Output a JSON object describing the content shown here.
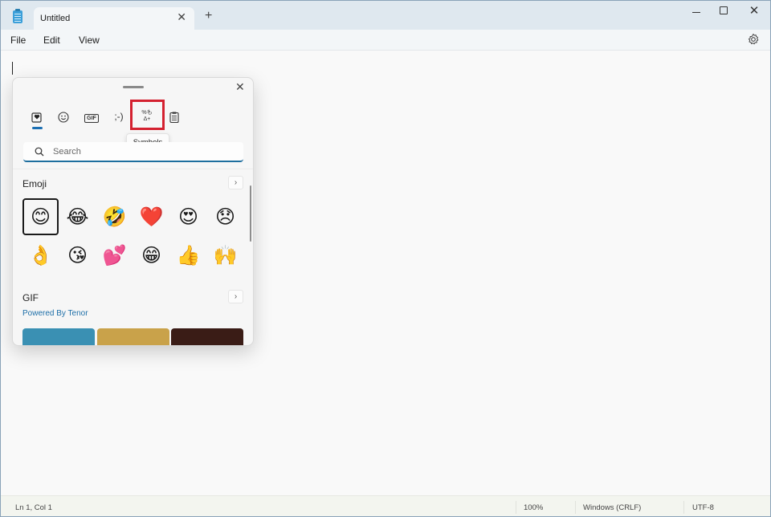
{
  "window": {
    "tab_title": "Untitled",
    "tab_close_glyph": "✕",
    "new_tab_glyph": "+",
    "close_glyph": "✕"
  },
  "menu": {
    "items": [
      "File",
      "Edit",
      "View"
    ]
  },
  "status": {
    "position": "Ln 1, Col 1",
    "zoom": "100%",
    "line_ending": "Windows (CRLF)",
    "encoding": "UTF-8"
  },
  "emoji_panel": {
    "close_glyph": "✕",
    "tabs": [
      {
        "name": "favorites",
        "glyph": "♥",
        "label": "Most recently used"
      },
      {
        "name": "emoji",
        "glyph": "☺",
        "label": "Emoji"
      },
      {
        "name": "gif",
        "glyph": "GIF",
        "label": "GIF"
      },
      {
        "name": "kaomoji",
        "glyph": ";-)",
        "label": "Kaomoji"
      },
      {
        "name": "symbols",
        "glyph": "%Ω",
        "label": "Symbols"
      },
      {
        "name": "clipboard",
        "glyph": "▤",
        "label": "Clipboard history"
      }
    ],
    "active_tab": "favorites",
    "highlighted_tab": "symbols",
    "tooltip": "Symbols",
    "search": {
      "placeholder": "Search",
      "value": ""
    },
    "emoji_section": {
      "title": "Emoji",
      "more_glyph": "›",
      "items": [
        {
          "name": "smiling-face",
          "char": "😊"
        },
        {
          "name": "tears-of-joy",
          "char": "😂"
        },
        {
          "name": "rolling-on-floor-laughing",
          "char": "🤣"
        },
        {
          "name": "red-heart",
          "char": "❤️"
        },
        {
          "name": "heart-eyes",
          "char": "😍"
        },
        {
          "name": "disappointed-face",
          "char": "😞"
        },
        {
          "name": "ok-hand",
          "char": "👌"
        },
        {
          "name": "face-blowing-kiss",
          "char": "😘"
        },
        {
          "name": "two-hearts",
          "char": "💕"
        },
        {
          "name": "beaming-face",
          "char": "😁"
        },
        {
          "name": "thumbs-up",
          "char": "👍"
        },
        {
          "name": "raising-hands",
          "char": "🙌"
        }
      ],
      "selected_index": 0
    },
    "gif_section": {
      "title": "GIF",
      "more_glyph": "›",
      "powered_by": "Powered By Tenor",
      "thumbs": [
        {
          "name": "gif-thumb-1",
          "color": "#3a90b3"
        },
        {
          "name": "gif-thumb-2",
          "color": "#c9a24a"
        },
        {
          "name": "gif-thumb-3",
          "color": "#3a1c16"
        }
      ]
    }
  },
  "colors": {
    "accent": "#1b6fb3",
    "highlight_box": "#d42130",
    "link": "#1e6fa8"
  }
}
